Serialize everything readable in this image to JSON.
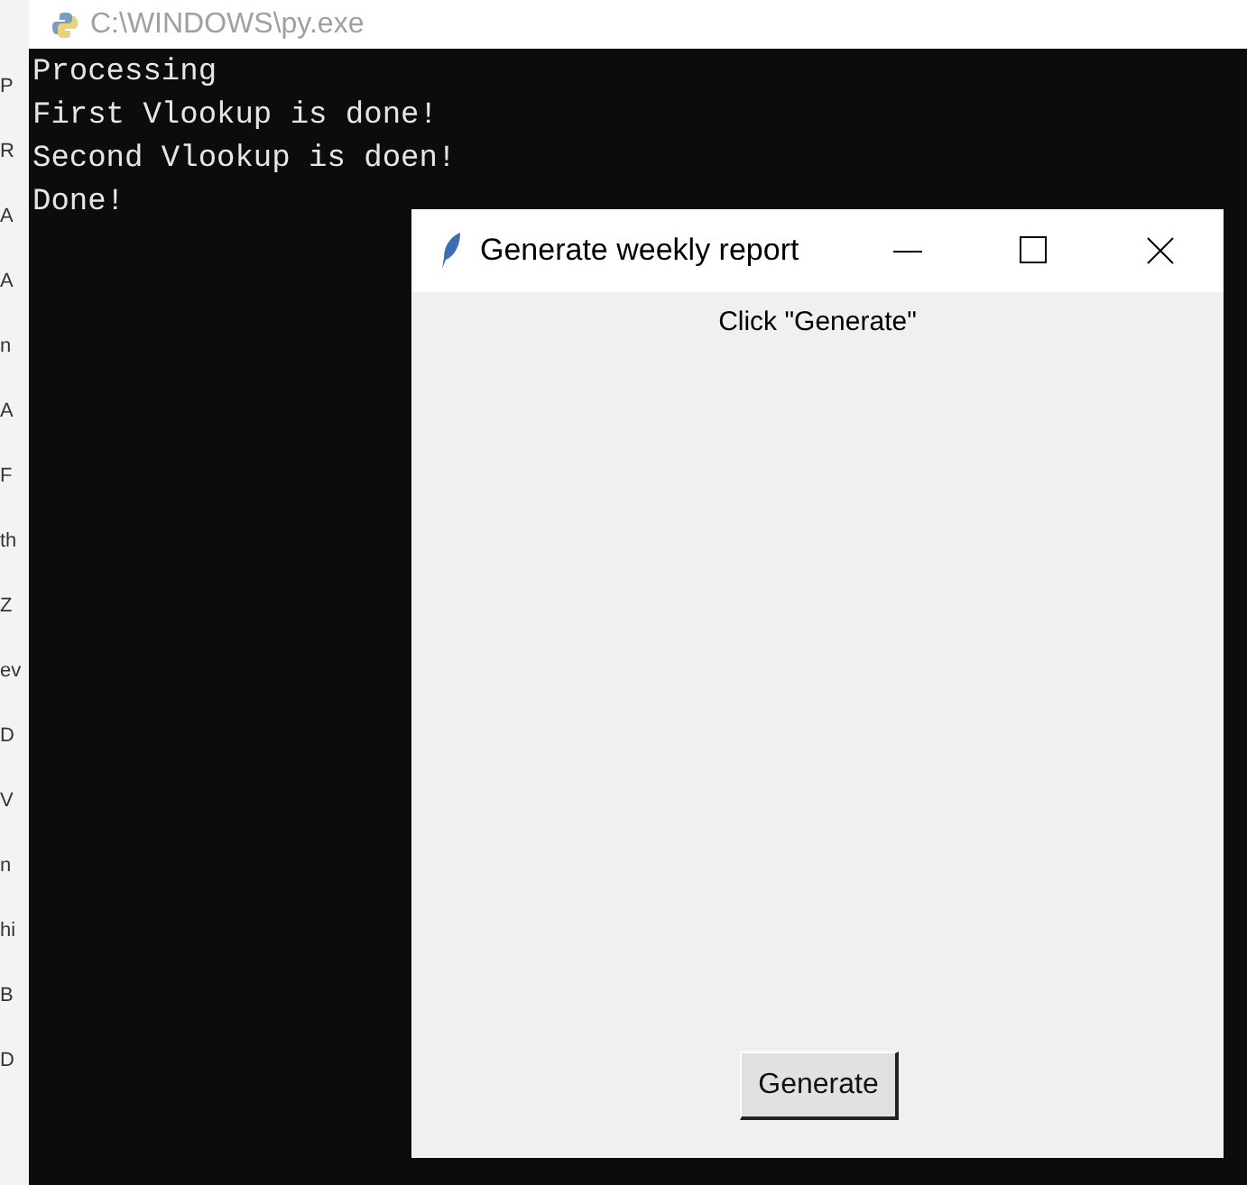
{
  "background_window": {
    "fragments": [
      "P",
      "R",
      "A",
      "A",
      "n",
      "A",
      "F",
      "th",
      "Z",
      "ev",
      "D",
      "V",
      "n",
      "hi",
      "B",
      "D"
    ]
  },
  "console": {
    "title": "C:\\WINDOWS\\py.exe",
    "lines": [
      "Processing",
      "First Vlookup is done!",
      "Second Vlookup is doen!",
      "Done!"
    ]
  },
  "dialog": {
    "title": "Generate weekly report",
    "label": "Click \"Generate\"",
    "button": "Generate"
  }
}
